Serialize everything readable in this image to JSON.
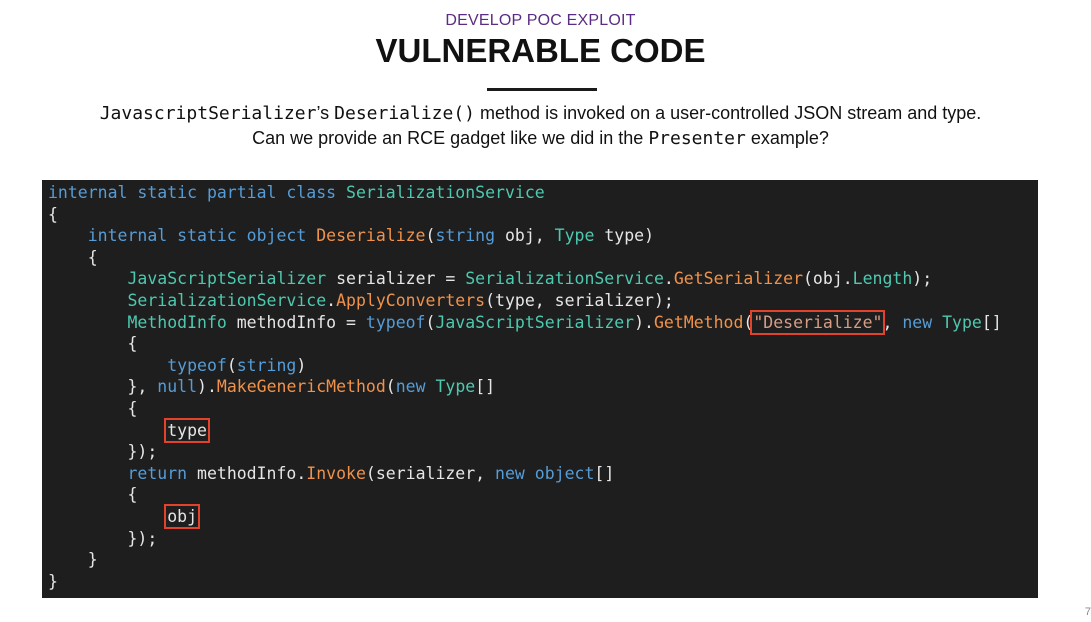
{
  "kicker": "DEVELOP POC EXPLOIT",
  "title": "VULNERABLE CODE",
  "description": {
    "line1_code_a": "JavascriptSerializer",
    "line1_text_a": "’s ",
    "line1_code_b": "Deserialize()",
    "line1_text_b": " method is invoked on a user-controlled JSON stream and type.",
    "line2_text_a": "Can we provide an RCE gadget like we did in the ",
    "line2_code": "Presenter",
    "line2_text_b": " example?"
  },
  "code": {
    "lines": [
      [
        [
          "kw",
          "internal static partial class "
        ],
        [
          "ty",
          "SerializationService"
        ]
      ],
      [
        [
          "pu",
          "{"
        ]
      ],
      [
        [
          "kw",
          "    internal static object "
        ],
        [
          "fn",
          "Deserialize"
        ],
        [
          "pu",
          "("
        ],
        [
          "kw",
          "string "
        ],
        [
          "id",
          "obj, "
        ],
        [
          "ty",
          "Type "
        ],
        [
          "id",
          "type)"
        ]
      ],
      [
        [
          "pu",
          "    {"
        ]
      ],
      [
        [
          "ty",
          "        JavaScriptSerializer "
        ],
        [
          "id",
          "serializer = "
        ],
        [
          "ty",
          "SerializationService"
        ],
        [
          "pu",
          "."
        ],
        [
          "fn",
          "GetSerializer"
        ],
        [
          "pu",
          "(obj."
        ],
        [
          "ty",
          "Length"
        ],
        [
          "pu",
          ");"
        ]
      ],
      [
        [
          "ty",
          "        SerializationService"
        ],
        [
          "pu",
          "."
        ],
        [
          "fn",
          "ApplyConverters"
        ],
        [
          "pu",
          "(type, serializer);"
        ]
      ],
      [
        [
          "ty",
          "        MethodInfo "
        ],
        [
          "id",
          "methodInfo = "
        ],
        [
          "kw",
          "typeof"
        ],
        [
          "pu",
          "("
        ],
        [
          "ty",
          "JavaScriptSerializer"
        ],
        [
          "pu",
          ")."
        ],
        [
          "fn",
          "GetMethod"
        ],
        [
          "pu",
          "("
        ],
        [
          "str",
          "\"Deserialize\"",
          "hl"
        ],
        [
          "pu",
          ", "
        ],
        [
          "kw",
          "new "
        ],
        [
          "ty",
          "Type"
        ],
        [
          "pu",
          "[]"
        ]
      ],
      [
        [
          "pu",
          "        {"
        ]
      ],
      [
        [
          "kw",
          "            typeof"
        ],
        [
          "pu",
          "("
        ],
        [
          "kw",
          "string"
        ],
        [
          "pu",
          ")"
        ]
      ],
      [
        [
          "pu",
          "        }, "
        ],
        [
          "kw",
          "null"
        ],
        [
          "pu",
          ")."
        ],
        [
          "fn",
          "MakeGenericMethod"
        ],
        [
          "pu",
          "("
        ],
        [
          "kw",
          "new "
        ],
        [
          "ty",
          "Type"
        ],
        [
          "pu",
          "[]"
        ]
      ],
      [
        [
          "pu",
          "        {"
        ]
      ],
      [
        [
          "pu",
          "            "
        ],
        [
          "id",
          "type",
          "hl"
        ]
      ],
      [
        [
          "pu",
          "        });"
        ]
      ],
      [
        [
          "kw",
          "        return "
        ],
        [
          "id",
          "methodInfo."
        ],
        [
          "fn",
          "Invoke"
        ],
        [
          "pu",
          "(serializer, "
        ],
        [
          "kw",
          "new object"
        ],
        [
          "pu",
          "[]"
        ]
      ],
      [
        [
          "pu",
          "        {"
        ]
      ],
      [
        [
          "pu",
          "            "
        ],
        [
          "id",
          "obj",
          "hl"
        ]
      ],
      [
        [
          "pu",
          "        });"
        ]
      ],
      [
        [
          "pu",
          "    }"
        ]
      ],
      [
        [
          "pu",
          "}"
        ]
      ]
    ]
  },
  "page_number": "7"
}
